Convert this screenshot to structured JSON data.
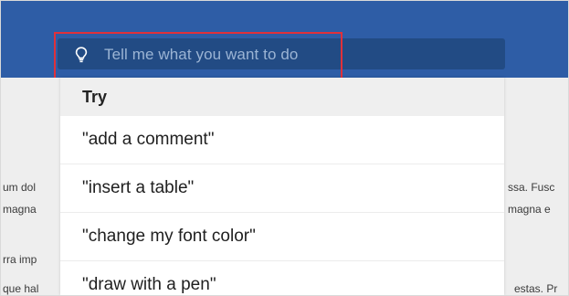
{
  "tell_me": {
    "placeholder": "Tell me what you want to do",
    "icon": "lightbulb-icon"
  },
  "suggestions": {
    "header": "Try",
    "items": [
      "\"add a comment\"",
      "\"insert a table\"",
      "\"change my font color\"",
      "\"draw with a pen\""
    ]
  },
  "document_fragments": {
    "left": [
      "um dol",
      "magna",
      "rra imp",
      "que hal"
    ],
    "right": [
      "ssa. Fusc",
      "magna e",
      "estas. Pr"
    ]
  },
  "colors": {
    "ribbon": "#2e5da6",
    "search_box": "#224b84",
    "highlight": "#e0313a",
    "document_bg": "#eeeeee"
  }
}
